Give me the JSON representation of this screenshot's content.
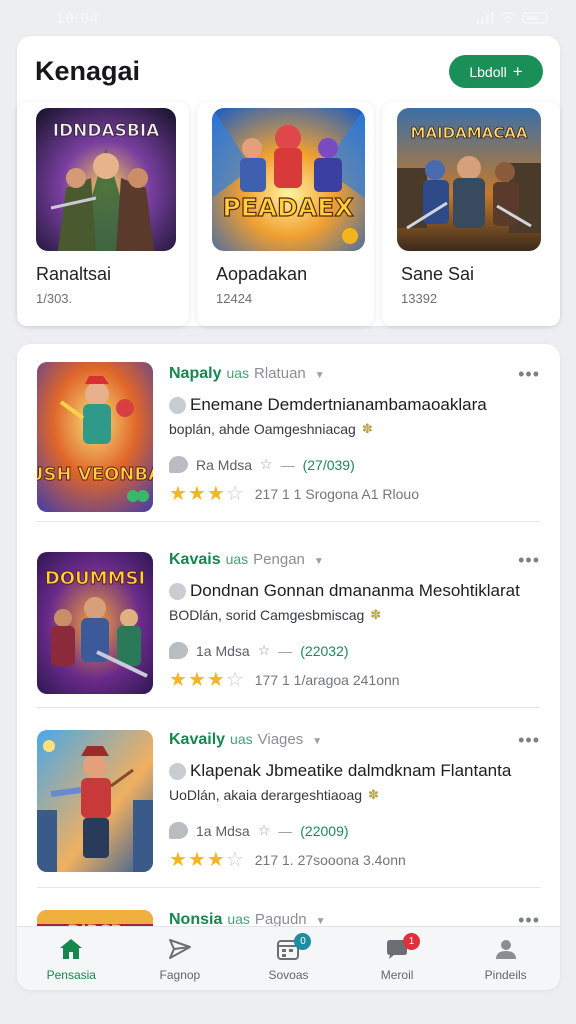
{
  "status_bar": {
    "time": "10:04"
  },
  "header": {
    "title": "Kenagai",
    "follow_label": "Lbdoll"
  },
  "featured": [
    {
      "art_title": "IDNDASBIA",
      "name": "Ranaltsai",
      "count": "1/303."
    },
    {
      "art_title": "PEADAEX",
      "name": "Aopadakan",
      "count": "12424"
    },
    {
      "art_title": "MAIDAMACAA",
      "name": "Sane Sai",
      "count": "13392"
    }
  ],
  "posts": [
    {
      "art_title": "RUSH VEONBAS",
      "author": "Napaly",
      "sub1": "uas",
      "sub2": "Rlatuan",
      "headline": "Enemane Demdertnianambamaoaklara",
      "subline": "boplán, ahde Oamgeshniacag",
      "reads": "Ra Mdsa",
      "score": "(27/039)",
      "rating": 3,
      "footer": "217 1 1 Srogona A1 Rlouo"
    },
    {
      "art_title": "DOUMMSI",
      "author": "Kavais",
      "sub1": "uas",
      "sub2": "Pengan",
      "headline": "Dondnan Gonnan dmananma Mesohtiklarat",
      "subline": "BODlán, sorid Camgesbmiscag",
      "reads": "1a Mdsa",
      "score": "(22032)",
      "rating": 3,
      "footer": "177 1 1/aragoa 241onn"
    },
    {
      "art_title": "",
      "author": "Kavaily",
      "sub1": "uas",
      "sub2": "Viages",
      "headline": "Klapenak Jbmeatike dalmdknam Flantanta",
      "subline": "UoDlán, akaia derargeshtiaoag",
      "reads": "1a Mdsa",
      "score": "(22009)",
      "rating": 3,
      "footer": "217 1. 27sooona 3.4onn"
    },
    {
      "art_title": "DIRCR",
      "author": "Nonsia",
      "sub1": "uas",
      "sub2": "Pagudn",
      "headline": "",
      "subline": "",
      "reads": "",
      "score": "",
      "rating": 0,
      "footer": ""
    }
  ],
  "nav": [
    {
      "label": "Pensasia",
      "icon": "home-icon",
      "active": true,
      "badge": ""
    },
    {
      "label": "Fagnop",
      "icon": "send-icon",
      "active": false,
      "badge": ""
    },
    {
      "label": "Sovoas",
      "icon": "calendar-icon",
      "active": false,
      "badge": "0"
    },
    {
      "label": "Meroil",
      "icon": "chat-icon",
      "active": false,
      "badge": "1"
    },
    {
      "label": "Pindeils",
      "icon": "profile-icon",
      "active": false,
      "badge": ""
    }
  ],
  "colors": {
    "accent_green": "#1a8f57",
    "star_yellow": "#f2b623",
    "badge_teal": "#1c8ea0",
    "badge_red": "#e0303a"
  }
}
